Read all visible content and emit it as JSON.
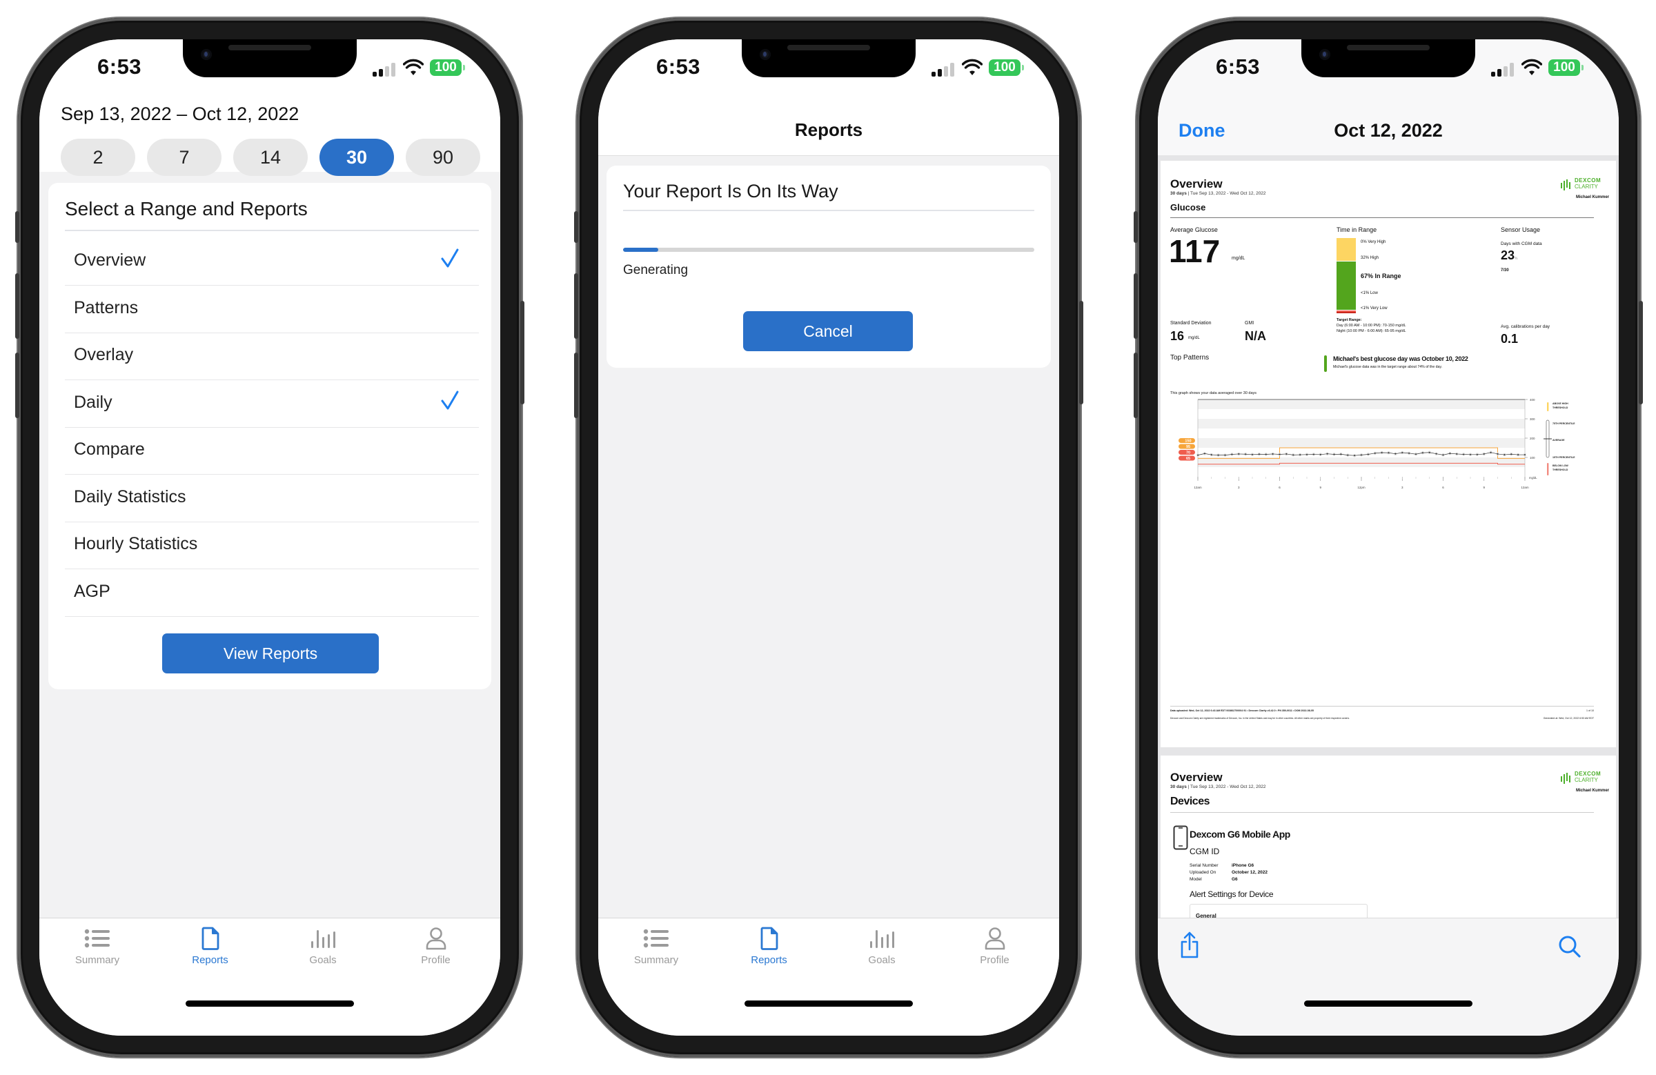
{
  "status_bar": {
    "time": "6:53",
    "battery": "100"
  },
  "tabbar": {
    "items": [
      {
        "label": "Summary",
        "icon": "list-icon"
      },
      {
        "label": "Reports",
        "icon": "document-icon",
        "active": true
      },
      {
        "label": "Goals",
        "icon": "bar-chart-icon"
      },
      {
        "label": "Profile",
        "icon": "person-icon"
      }
    ],
    "active_color": "#2a78d2"
  },
  "screen1": {
    "date_range": "Sep 13, 2022 – Oct 12, 2022",
    "range_options": [
      "2",
      "7",
      "14",
      "30",
      "90"
    ],
    "selected_range": "30",
    "card_title": "Select a Range and Reports",
    "reports": [
      {
        "label": "Overview",
        "checked": true
      },
      {
        "label": "Patterns",
        "checked": false
      },
      {
        "label": "Overlay",
        "checked": false
      },
      {
        "label": "Daily",
        "checked": true
      },
      {
        "label": "Compare",
        "checked": false
      },
      {
        "label": "Daily Statistics",
        "checked": false
      },
      {
        "label": "Hourly Statistics",
        "checked": false
      },
      {
        "label": "AGP",
        "checked": false
      }
    ],
    "view_button": "View Reports"
  },
  "screen2": {
    "nav_title": "Reports",
    "card_title": "Your Report Is On Its Way",
    "progress_fraction": 0.085,
    "status_text": "Generating",
    "cancel_button": "Cancel"
  },
  "screen3": {
    "done_label": "Done",
    "nav_title": "Oct 12, 2022",
    "page1": {
      "heading": "Overview",
      "period_bold": "30 days",
      "period_range": "Tue Sep 13, 2022 - Wed Oct 12, 2022",
      "logo_line1": "DEXCOM",
      "logo_line2": "CLARITY",
      "patient": "Michael Kummer",
      "section": "Glucose",
      "avg_label": "Average Glucose",
      "avg_value": "117",
      "avg_unit": "mg/dL",
      "sd_label": "Standard Deviation",
      "sd_value": "16",
      "sd_unit": "mg/dL",
      "gmi_label": "GMI",
      "gmi_value": "N/A",
      "tir_label": "Time in Range",
      "tir": [
        {
          "label": "0% Very High",
          "pct": 0,
          "color": "#f3b92b"
        },
        {
          "label": "32% High",
          "pct": 32,
          "color": "#fdd562"
        },
        {
          "label": "67% In Range",
          "pct": 67,
          "color": "#53a51d"
        },
        {
          "label": "<1% Low",
          "pct": 0.5,
          "color": "#ef5d4e"
        },
        {
          "label": "<1% Very Low",
          "pct": 0.5,
          "color": "#c9271e"
        }
      ],
      "target_label": "Target Range:",
      "target_day": "Day (6:00 AM - 10:00 PM): 70-150 mg/dL",
      "target_night": "Night (10:00 PM - 6:00 AM): 65-95 mg/dL",
      "sensor_label": "Sensor Usage",
      "cgm_days_label": "Days with CGM data",
      "cgm_days_pct": "23",
      "cgm_days_pct_unit": "%",
      "cgm_days_frac": "7/30",
      "cal_label": "Avg. calibrations per day",
      "cal_value": "0.1",
      "patterns_label": "Top Patterns",
      "pattern_title": "Michael's best glucose day was October 10, 2022",
      "pattern_sub": "Michael's glucose data was in the target range about 74% of the day.",
      "graph_caption": "This graph shows your data averaged over 30 days",
      "footer_line1": "Data uploaded: Wed, Oct 12, 2022 6:43 AM EDT    003862700004 91  •  Dexcom Clarity v3.42.0  •  PN 350-0011  •  DOM 2022-08-05",
      "footer_page": "1 of 10",
      "footer_line2": "Dexcom and Dexcom Clarity are registered trademarks of Dexcom, Inc. in the United States and may be in other countries. All other marks are property of their respective owners.",
      "footer_generated": "Generated at: Wed, Oct 12, 2022 6:53 AM EDT"
    },
    "page2": {
      "heading": "Overview",
      "period_bold": "30 days",
      "period_range": "Tue Sep 13, 2022 - Wed Oct 12, 2022",
      "logo_line1": "DEXCOM",
      "logo_line2": "CLARITY",
      "patient": "Michael Kummer",
      "section": "Devices",
      "device_name": "Dexcom G6 Mobile App",
      "cgm_id_label": "CGM ID",
      "fields": [
        {
          "label": "Serial Number",
          "value": "iPhone G6"
        },
        {
          "label": "Uploaded On",
          "value": "October 12, 2022"
        },
        {
          "label": "Model",
          "value": "G6"
        }
      ],
      "alert_settings_label": "Alert Settings for Device",
      "general_label": "General"
    }
  },
  "chart_data": {
    "type": "line",
    "title": "This graph shows your data averaged over 30 days",
    "xlabel": "",
    "ylabel": "mg/dL",
    "x_ticks": [
      "12am",
      "3",
      "6",
      "9",
      "12pm",
      "3",
      "6",
      "9",
      "12am"
    ],
    "y_ticks": [
      100,
      200,
      300,
      400
    ],
    "ylim": [
      0,
      400
    ],
    "x_hours": [
      0,
      0.5,
      1,
      1.5,
      2,
      2.5,
      3,
      3.5,
      4,
      4.5,
      5,
      5.5,
      6,
      6.5,
      7,
      7.5,
      8,
      8.5,
      9,
      9.5,
      10,
      10.5,
      11,
      11.5,
      12,
      12.5,
      13,
      13.5,
      14,
      14.5,
      15,
      15.5,
      16,
      16.5,
      17,
      17.5,
      18,
      18.5,
      19,
      19.5,
      20,
      20.5,
      21,
      21.5,
      22,
      22.5,
      23,
      23.5,
      24
    ],
    "series": [
      {
        "name": "Average",
        "values": [
          112,
          120,
          114,
          112,
          112,
          116,
          118,
          117,
          115,
          117,
          116,
          118,
          116,
          118,
          113,
          114,
          115,
          116,
          115,
          119,
          116,
          117,
          112,
          110,
          113,
          116,
          122,
          125,
          124,
          119,
          125,
          122,
          117,
          124,
          126,
          119,
          113,
          121,
          118,
          116,
          115,
          115,
          118,
          126,
          118,
          114,
          117,
          114,
          114
        ]
      }
    ],
    "thresholds": {
      "day_high": 150,
      "night_high": 95,
      "day_low": 70,
      "night_low": 65,
      "day_start_hour": 6,
      "day_end_hour": 22
    },
    "threshold_badges": [
      "150",
      "95",
      "70",
      "65"
    ],
    "legend": [
      "ABOVE HIGH THRESHOLD",
      "75TH PERCENTILE",
      "AVERAGE",
      "15TH PERCENTILE",
      "BELOW LOW THRESHOLD"
    ],
    "legend_position": "right"
  },
  "toolbar": {
    "share_icon": "share-icon",
    "search_icon": "search-icon"
  }
}
